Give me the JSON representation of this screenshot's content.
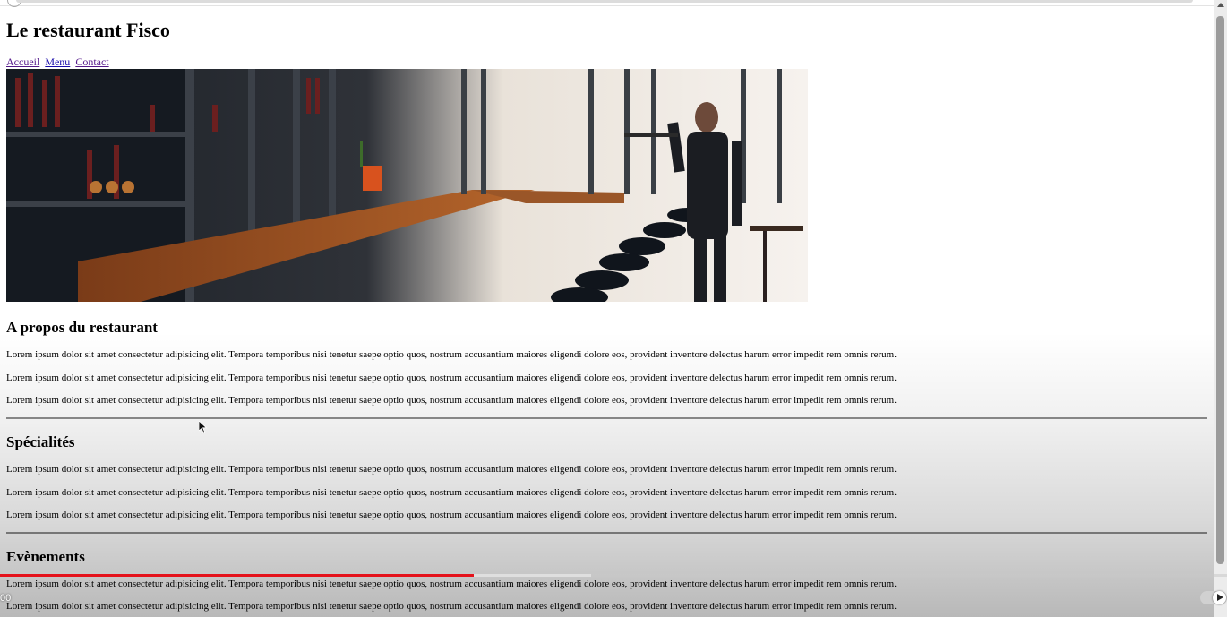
{
  "page": {
    "title": "Le restaurant Fisco",
    "nav": [
      "Accueil",
      "Menu",
      "Contact"
    ],
    "hero_alt": "Intérieur du restaurant"
  },
  "sections": [
    {
      "heading": "A propos du restaurant",
      "paragraphs": [
        "Lorem ipsum dolor sit amet consectetur adipisicing elit. Tempora temporibus nisi tenetur saepe optio quos, nostrum accusantium maiores eligendi dolore eos, provident inventore delectus harum error impedit rem omnis rerum.",
        "Lorem ipsum dolor sit amet consectetur adipisicing elit. Tempora temporibus nisi tenetur saepe optio quos, nostrum accusantium maiores eligendi dolore eos, provident inventore delectus harum error impedit rem omnis rerum.",
        "Lorem ipsum dolor sit amet consectetur adipisicing elit. Tempora temporibus nisi tenetur saepe optio quos, nostrum accusantium maiores eligendi dolore eos, provident inventore delectus harum error impedit rem omnis rerum."
      ]
    },
    {
      "heading": "Spécialités",
      "paragraphs": [
        "Lorem ipsum dolor sit amet consectetur adipisicing elit. Tempora temporibus nisi tenetur saepe optio quos, nostrum accusantium maiores eligendi dolore eos, provident inventore delectus harum error impedit rem omnis rerum.",
        "Lorem ipsum dolor sit amet consectetur adipisicing elit. Tempora temporibus nisi tenetur saepe optio quos, nostrum accusantium maiores eligendi dolore eos, provident inventore delectus harum error impedit rem omnis rerum.",
        "Lorem ipsum dolor sit amet consectetur adipisicing elit. Tempora temporibus nisi tenetur saepe optio quos, nostrum accusantium maiores eligendi dolore eos, provident inventore delectus harum error impedit rem omnis rerum."
      ]
    },
    {
      "heading": "Evènements",
      "paragraphs": [
        "Lorem ipsum dolor sit amet consectetur adipisicing elit. Tempora temporibus nisi tenetur saepe optio quos, nostrum accusantium maiores eligendi dolore eos, provident inventore delectus harum error impedit rem omnis rerum.",
        "Lorem ipsum dolor sit amet consectetur adipisicing elit. Tempora temporibus nisi tenetur saepe optio quos, nostrum accusantium maiores eligendi dolore eos, provident inventore delectus harum error impedit rem omnis rerum."
      ]
    }
  ],
  "player": {
    "time_label": "00",
    "played_fraction": 0.386,
    "buffered_fraction": 0.482
  },
  "colors": {
    "link": "#1a0dab",
    "link_visited": "#551a8b",
    "progress": "#e5121b"
  }
}
